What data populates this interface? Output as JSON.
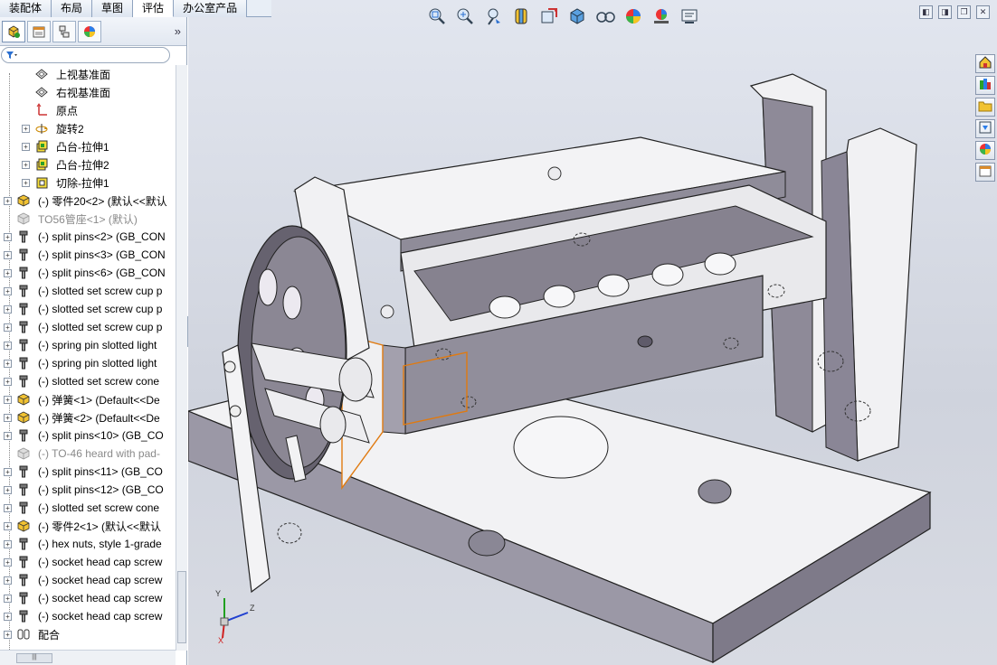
{
  "command_tabs": [
    {
      "label": "装配体",
      "active": false
    },
    {
      "label": "布局",
      "active": false
    },
    {
      "label": "草图",
      "active": false
    },
    {
      "label": "评估",
      "active": true
    },
    {
      "label": "办公室产品",
      "active": false
    }
  ],
  "panel_tabs": [
    {
      "icon": "feature-manager-icon"
    },
    {
      "icon": "property-manager-icon"
    },
    {
      "icon": "configuration-manager-icon"
    },
    {
      "icon": "display-manager-icon"
    }
  ],
  "panel_expand_glyph": "»",
  "tree": {
    "items": [
      {
        "label": "上视基准面",
        "icon": "plane-icon",
        "indent": 2,
        "expandable": false,
        "dim": false
      },
      {
        "label": "右视基准面",
        "icon": "plane-icon",
        "indent": 2,
        "expandable": false,
        "dim": false
      },
      {
        "label": "原点",
        "icon": "origin-icon",
        "indent": 2,
        "expandable": false,
        "dim": false
      },
      {
        "label": "旋转2",
        "icon": "revolve-icon",
        "indent": 2,
        "expandable": true,
        "dim": false
      },
      {
        "label": "凸台-拉伸1",
        "icon": "extrude-icon",
        "indent": 2,
        "expandable": true,
        "dim": false
      },
      {
        "label": "凸台-拉伸2",
        "icon": "extrude-icon",
        "indent": 2,
        "expandable": true,
        "dim": false
      },
      {
        "label": "切除-拉伸1",
        "icon": "cut-icon",
        "indent": 2,
        "expandable": true,
        "dim": false
      },
      {
        "label": "(-) 零件20<2> (默认<<默认",
        "icon": "part-icon",
        "indent": 1,
        "expandable": true,
        "dim": false
      },
      {
        "label": "TO56管座<1> (默认)",
        "icon": "part-suppressed-icon",
        "indent": 1,
        "expandable": false,
        "dim": true
      },
      {
        "label": "(-) split pins<2> (GB_CON",
        "icon": "toolbox-part-icon",
        "indent": 1,
        "expandable": true,
        "dim": false
      },
      {
        "label": "(-) split pins<3> (GB_CON",
        "icon": "toolbox-part-icon",
        "indent": 1,
        "expandable": true,
        "dim": false
      },
      {
        "label": "(-) split pins<6> (GB_CON",
        "icon": "toolbox-part-icon",
        "indent": 1,
        "expandable": true,
        "dim": false
      },
      {
        "label": "(-) slotted set screw cup p",
        "icon": "toolbox-part-icon",
        "indent": 1,
        "expandable": true,
        "dim": false
      },
      {
        "label": "(-) slotted set screw cup p",
        "icon": "toolbox-part-icon",
        "indent": 1,
        "expandable": true,
        "dim": false
      },
      {
        "label": "(-) slotted set screw cup p",
        "icon": "toolbox-part-icon",
        "indent": 1,
        "expandable": true,
        "dim": false
      },
      {
        "label": "(-) spring pin slotted light",
        "icon": "toolbox-part-icon",
        "indent": 1,
        "expandable": true,
        "dim": false
      },
      {
        "label": "(-) spring pin slotted light",
        "icon": "toolbox-part-icon",
        "indent": 1,
        "expandable": true,
        "dim": false
      },
      {
        "label": "(-) slotted set screw cone",
        "icon": "toolbox-part-icon",
        "indent": 1,
        "expandable": true,
        "dim": false
      },
      {
        "label": "(-) 弹簧<1> (Default<<De",
        "icon": "part-icon",
        "indent": 1,
        "expandable": true,
        "dim": false
      },
      {
        "label": "(-) 弹簧<2> (Default<<De",
        "icon": "part-icon",
        "indent": 1,
        "expandable": true,
        "dim": false
      },
      {
        "label": "(-) split pins<10> (GB_CO",
        "icon": "toolbox-part-icon",
        "indent": 1,
        "expandable": true,
        "dim": false
      },
      {
        "label": "(-) TO-46 heard with pad-",
        "icon": "part-suppressed-icon",
        "indent": 1,
        "expandable": false,
        "dim": true
      },
      {
        "label": "(-) split pins<11> (GB_CO",
        "icon": "toolbox-part-icon",
        "indent": 1,
        "expandable": true,
        "dim": false
      },
      {
        "label": "(-) split pins<12> (GB_CO",
        "icon": "toolbox-part-icon",
        "indent": 1,
        "expandable": true,
        "dim": false
      },
      {
        "label": "(-) slotted set screw cone",
        "icon": "toolbox-part-icon",
        "indent": 1,
        "expandable": true,
        "dim": false
      },
      {
        "label": "(-) 零件2<1> (默认<<默认",
        "icon": "part-icon",
        "indent": 1,
        "expandable": true,
        "dim": false
      },
      {
        "label": "(-) hex nuts, style 1-grade",
        "icon": "toolbox-part-icon",
        "indent": 1,
        "expandable": true,
        "dim": false
      },
      {
        "label": "(-) socket head cap screw",
        "icon": "toolbox-part-icon",
        "indent": 1,
        "expandable": true,
        "dim": false
      },
      {
        "label": "(-) socket head cap screw",
        "icon": "toolbox-part-icon",
        "indent": 1,
        "expandable": true,
        "dim": false
      },
      {
        "label": "(-) socket head cap screw",
        "icon": "toolbox-part-icon",
        "indent": 1,
        "expandable": true,
        "dim": false
      },
      {
        "label": "(-) socket head cap screw",
        "icon": "toolbox-part-icon",
        "indent": 1,
        "expandable": true,
        "dim": false
      },
      {
        "label": "配合",
        "icon": "mates-icon",
        "indent": 1,
        "expandable": true,
        "dim": false
      }
    ]
  },
  "hscroll_thumb_glyph": "|||",
  "splitter_glyph": "◂◂◂",
  "heads_up_toolbar": [
    {
      "name": "zoom-to-fit-icon"
    },
    {
      "name": "zoom-to-area-icon"
    },
    {
      "name": "previous-view-icon"
    },
    {
      "name": "section-view-icon"
    },
    {
      "name": "view-orientation-icon"
    },
    {
      "name": "display-style-icon"
    },
    {
      "name": "hide-show-items-icon"
    },
    {
      "name": "edit-appearance-icon"
    },
    {
      "name": "apply-scene-icon"
    },
    {
      "name": "view-settings-icon"
    }
  ],
  "window_controls": [
    {
      "name": "tile-left-icon",
      "glyph": "◧"
    },
    {
      "name": "tile-right-icon",
      "glyph": "◨"
    },
    {
      "name": "restore-icon",
      "glyph": "❐"
    },
    {
      "name": "close-icon",
      "glyph": "✕"
    }
  ],
  "task_pane": [
    {
      "name": "resources-icon"
    },
    {
      "name": "design-library-icon"
    },
    {
      "name": "file-explorer-icon"
    },
    {
      "name": "view-palette-icon"
    },
    {
      "name": "appearances-icon"
    },
    {
      "name": "custom-properties-icon"
    }
  ],
  "triad": {
    "x_label": "X",
    "y_label": "Y",
    "z_label": "Z"
  },
  "colors": {
    "viewport_bg": "#d6dae3",
    "model_face": "#f3f3f5",
    "model_shade": "#8f8c99",
    "model_dark": "#6f6b7a",
    "selection_edge": "#e07a10",
    "tab_border": "#8fa3bf"
  }
}
